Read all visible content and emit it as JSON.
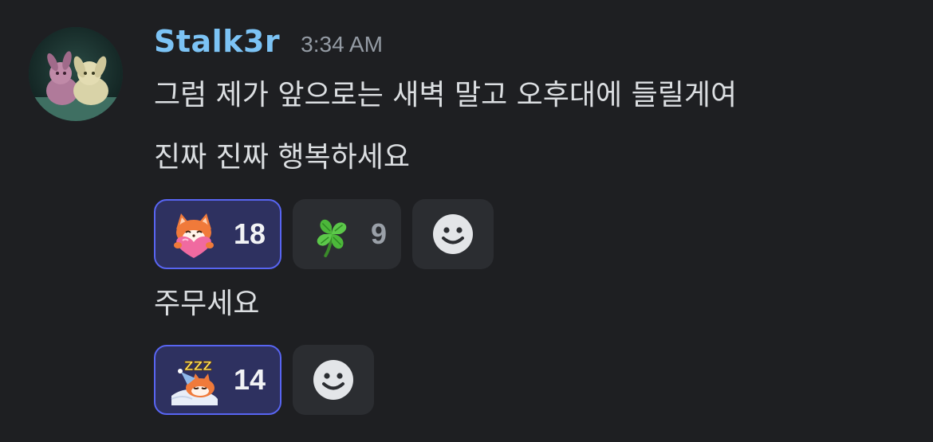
{
  "message": {
    "author": "Stalk3r",
    "timestamp": "3:34 AM",
    "lines": [
      "그럼 제가 앞으로는 새벽 말고 오후대에 들릴게여",
      "진짜 진짜 행복하세요",
      "주무세요"
    ]
  },
  "reactions_group_1": [
    {
      "emoji": "fox-heart-emoji",
      "count": "18",
      "active": true
    },
    {
      "emoji": "four-leaf-clover-emoji",
      "count": "9",
      "active": false
    }
  ],
  "reactions_group_2": [
    {
      "emoji": "sleeping-fox-emoji",
      "count": "14",
      "active": true
    }
  ],
  "colors": {
    "background": "#1e1f22",
    "username": "#7cc3f5",
    "reaction_active_bg": "#2e3160",
    "reaction_active_border": "#5865f2",
    "reaction_bg": "#2b2d31"
  }
}
